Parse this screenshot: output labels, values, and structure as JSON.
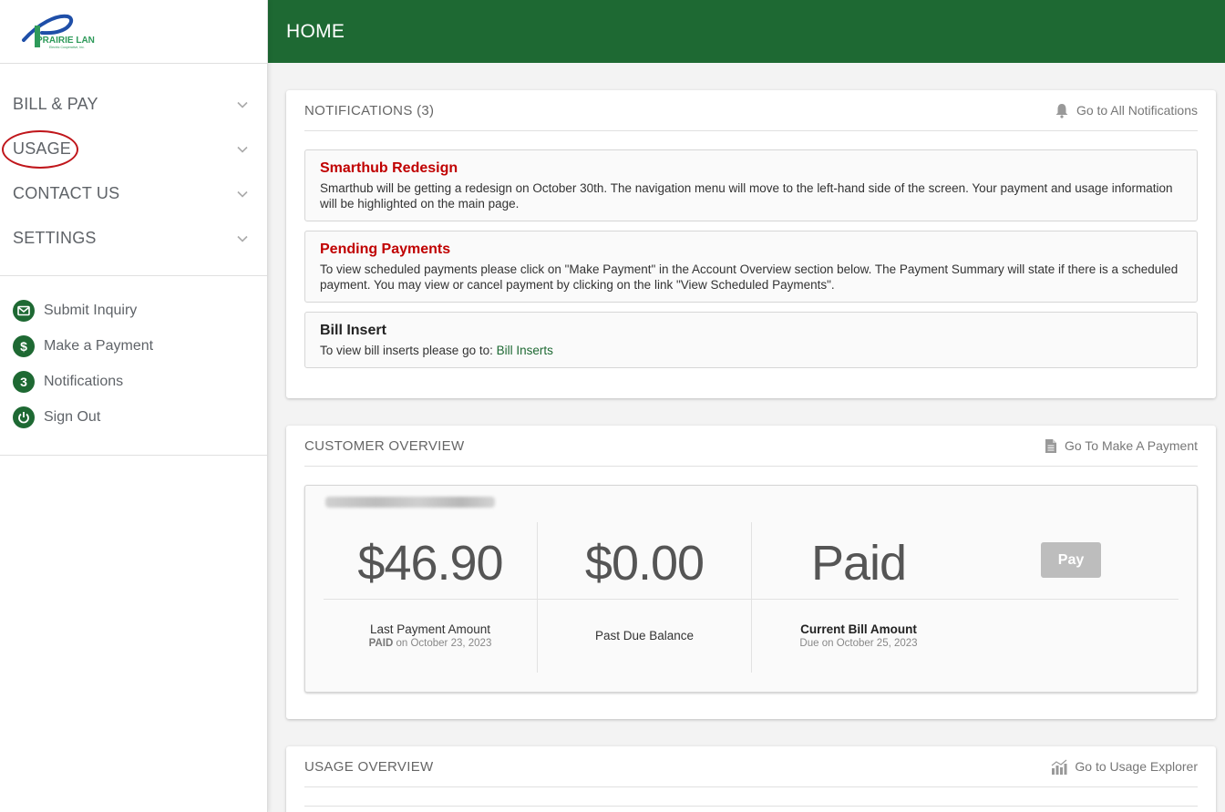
{
  "brand": {
    "name": "PRAIRIE LAND",
    "tagline": "Electric Cooperative, Inc.",
    "primary_color": "#1e6933",
    "alert_color": "#c00000",
    "highlight_color": "#c0161b"
  },
  "header": {
    "title": "HOME"
  },
  "sidebar": {
    "nav": [
      {
        "label": "BILL & PAY",
        "icon": "chevron-down-icon"
      },
      {
        "label": "USAGE",
        "icon": "chevron-down-icon",
        "annotated": true
      },
      {
        "label": "CONTACT US",
        "icon": "chevron-down-icon"
      },
      {
        "label": "SETTINGS",
        "icon": "chevron-down-icon"
      }
    ],
    "quick_links": [
      {
        "label": "Submit Inquiry",
        "icon": "envelope-icon"
      },
      {
        "label": "Make a Payment",
        "icon": "dollar-icon",
        "glyph": "$"
      },
      {
        "label": "Notifications",
        "icon": "notification-count-icon",
        "glyph": "3"
      },
      {
        "label": "Sign Out",
        "icon": "power-icon"
      }
    ]
  },
  "notifications": {
    "title": "NOTIFICATIONS (3)",
    "link_label": "Go to All Notifications",
    "link_icon": "bell-icon",
    "items": [
      {
        "title": "Smarthub Redesign",
        "text": "Smarthub will be getting a redesign on October 30th. The navigation menu will move to the left-hand side of the screen. Your payment and usage information will be highlighted on the main page."
      },
      {
        "title": "Pending Payments",
        "text": "To view scheduled payments please click on \"Make Payment\" in the Account Overview section below. The Payment Summary will state if there is a scheduled payment. You may view or cancel payment by clicking on the link \"View Scheduled Payments\"."
      },
      {
        "title": "Bill Insert",
        "text": "To view bill inserts please go to: ",
        "link": "Bill Inserts"
      }
    ]
  },
  "customer_overview": {
    "title": "CUSTOMER OVERVIEW",
    "link_label": "Go To Make A Payment",
    "link_icon": "document-icon",
    "last_payment": {
      "amount": "$46.90",
      "label": "Last Payment Amount",
      "status": "PAID",
      "date_text": "on October 23, 2023"
    },
    "past_due": {
      "amount": "$0.00",
      "label": "Past Due Balance"
    },
    "current_bill": {
      "amount": "Paid",
      "label": "Current Bill Amount",
      "due_text": "Due on October 25, 2023"
    },
    "pay_button": "Pay"
  },
  "usage_overview": {
    "title": "USAGE OVERVIEW",
    "link_label": "Go to Usage Explorer",
    "link_icon": "usage-chart-icon"
  }
}
